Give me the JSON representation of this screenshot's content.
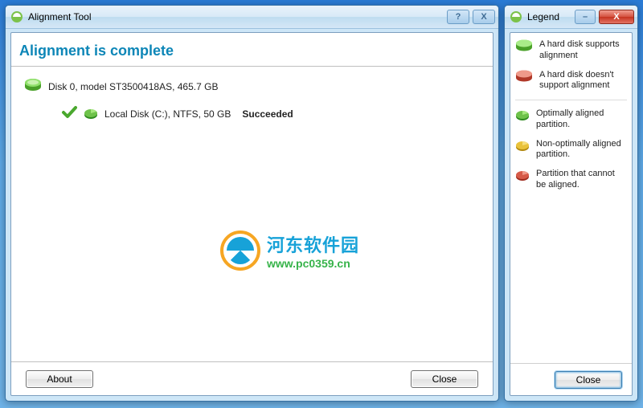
{
  "main": {
    "title": "Alignment Tool",
    "heading": "Alignment is complete",
    "disk_label": "Disk 0, model ST3500418AS, 465.7 GB",
    "partition_label": "Local Disk (C:), NTFS, 50 GB",
    "partition_status": "Succeeded",
    "buttons": {
      "about": "About",
      "close": "Close"
    }
  },
  "legend": {
    "title": "Legend",
    "items": [
      "A hard disk supports alignment",
      "A hard disk doesn't support alignment",
      "Optimally aligned partition.",
      "Non-optimally aligned partition.",
      "Partition that cannot be aligned."
    ],
    "close": "Close"
  },
  "watermark": {
    "line1": "河东软件园",
    "line2": "www.pc0359.cn"
  },
  "titlebar_glyphs": {
    "help": "?",
    "close": "X",
    "minimize": "–"
  }
}
